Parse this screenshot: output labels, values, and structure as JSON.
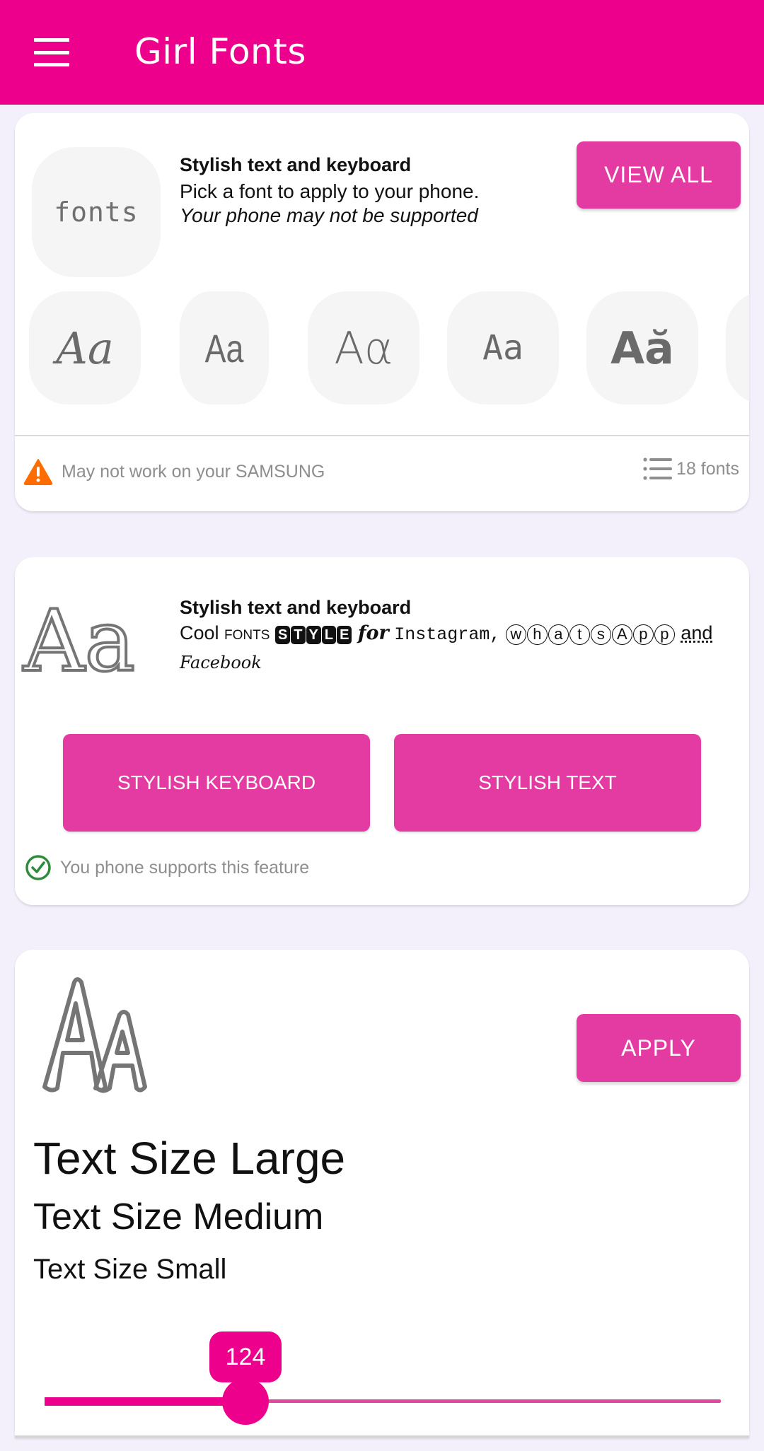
{
  "appbar": {
    "title": "Girl Fonts",
    "menu_icon": "hamburger-menu-icon",
    "background": "#ec008c"
  },
  "fonts_card": {
    "logo_text": "fonts",
    "title": "Stylish text and keyboard",
    "description": "Pick a font to apply to your phone.",
    "note": "Your phone may not be supported",
    "view_all_label": "VIEW ALL",
    "font_previews": [
      {
        "label": "Aa",
        "style": "curly-script"
      },
      {
        "label": "Aa",
        "style": "handwritten-narrow"
      },
      {
        "label": "Aα",
        "style": "handwritten-alpha"
      },
      {
        "label": "Aa",
        "style": "heart-doodle"
      },
      {
        "label": "Aă",
        "style": "heart-accent"
      },
      {
        "label": "",
        "style": "partially-visible"
      }
    ],
    "warning_icon": "warning-triangle-icon",
    "warning_text": "May not work on your SAMSUNG",
    "count_icon": "list-icon",
    "count_text": "18 fonts"
  },
  "stylish_card": {
    "title": "Stylish text and keyboard",
    "preview_parts": {
      "cool": "Cool ",
      "fonts": "fonts",
      "style_letters": [
        "S",
        "T",
        "Y",
        "L",
        "E"
      ],
      "for": "for",
      "instagram": "Instagram,",
      "whatsapp_letters": [
        "w",
        "h",
        "a",
        "t",
        "s",
        "A",
        "p",
        "p"
      ],
      "and": "and",
      "facebook": "Facebook"
    },
    "keyboard_button": "STYLISH KEYBOARD",
    "text_button": "STYLISH TEXT",
    "support_icon": "check-circle-icon",
    "support_text": "You phone supports this feature"
  },
  "size_card": {
    "apply_label": "APPLY",
    "large_label": "Text Size Large",
    "medium_label": "Text Size Medium",
    "small_label": "Text Size Small",
    "slider": {
      "value": "124",
      "fraction": 0.297
    }
  },
  "colors": {
    "accent": "#ec008c",
    "button": "#e33ba1",
    "warning": "#ff6d00",
    "success": "#2e8b3a"
  }
}
